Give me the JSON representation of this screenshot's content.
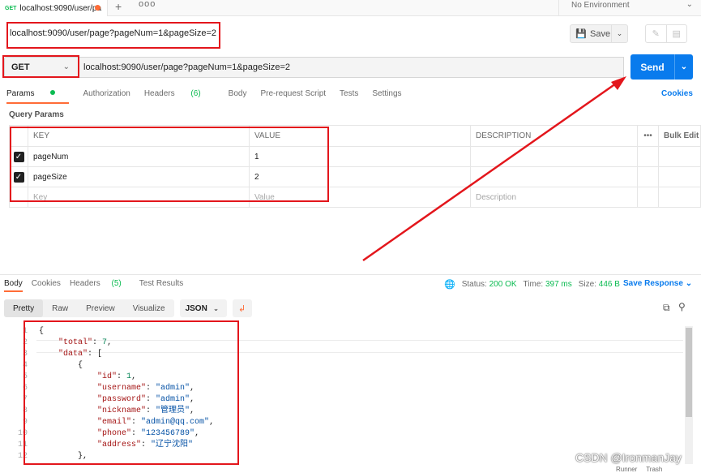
{
  "tab": {
    "method": "GET",
    "title": "localhost:9090/user/pa"
  },
  "new_tab_symbol": "+",
  "more_symbol": "ooo",
  "environment": {
    "label": "No Environment"
  },
  "request": {
    "name": "localhost:9090/user/page?pageNum=1&pageSize=2",
    "method": "GET",
    "url": "localhost:9090/user/page?pageNum=1&pageSize=2"
  },
  "toolbar": {
    "save_label": "Save",
    "send_label": "Send"
  },
  "request_tabs": {
    "params": "Params",
    "authorization": "Authorization",
    "headers": "Headers",
    "headers_count": "(6)",
    "body": "Body",
    "prerequest": "Pre-request Script",
    "tests": "Tests",
    "settings": "Settings",
    "cookies": "Cookies"
  },
  "query_params": {
    "title": "Query Params",
    "headers": {
      "key": "KEY",
      "value": "VALUE",
      "description": "DESCRIPTION",
      "dots": "•••",
      "bulk": "Bulk Edit"
    },
    "rows": [
      {
        "key": "pageNum",
        "value": "1"
      },
      {
        "key": "pageSize",
        "value": "2"
      }
    ],
    "placeholder": {
      "key": "Key",
      "value": "Value",
      "description": "Description"
    }
  },
  "response_tabs": {
    "body": "Body",
    "cookies": "Cookies",
    "headers": "Headers",
    "headers_count": "(5)",
    "test_results": "Test Results"
  },
  "response_status": {
    "status_label": "Status:",
    "status_value": "200 OK",
    "time_label": "Time:",
    "time_value": "397 ms",
    "size_label": "Size:",
    "size_value": "446 B",
    "save_response": "Save Response"
  },
  "format_bar": {
    "pretty": "Pretty",
    "raw": "Raw",
    "preview": "Preview",
    "visualize": "Visualize",
    "format": "JSON"
  },
  "response_body": [
    {
      "ln": "1",
      "tokens": [
        [
          "p",
          "{"
        ]
      ]
    },
    {
      "ln": "2",
      "tokens": [
        [
          "p",
          "    "
        ],
        [
          "k",
          "\"total\""
        ],
        [
          "p",
          ": "
        ],
        [
          "n",
          "7"
        ],
        [
          "p",
          ","
        ]
      ]
    },
    {
      "ln": "3",
      "tokens": [
        [
          "p",
          "    "
        ],
        [
          "k",
          "\"data\""
        ],
        [
          "p",
          ": ["
        ]
      ]
    },
    {
      "ln": "4",
      "tokens": [
        [
          "p",
          "        {"
        ]
      ]
    },
    {
      "ln": "5",
      "tokens": [
        [
          "p",
          "            "
        ],
        [
          "k",
          "\"id\""
        ],
        [
          "p",
          ": "
        ],
        [
          "n",
          "1"
        ],
        [
          "p",
          ","
        ]
      ]
    },
    {
      "ln": "6",
      "tokens": [
        [
          "p",
          "            "
        ],
        [
          "k",
          "\"username\""
        ],
        [
          "p",
          ": "
        ],
        [
          "s",
          "\"admin\""
        ],
        [
          "p",
          ","
        ]
      ]
    },
    {
      "ln": "7",
      "tokens": [
        [
          "p",
          "            "
        ],
        [
          "k",
          "\"password\""
        ],
        [
          "p",
          ": "
        ],
        [
          "s",
          "\"admin\""
        ],
        [
          "p",
          ","
        ]
      ]
    },
    {
      "ln": "8",
      "tokens": [
        [
          "p",
          "            "
        ],
        [
          "k",
          "\"nickname\""
        ],
        [
          "p",
          ": "
        ],
        [
          "s",
          "\"管理员\""
        ],
        [
          "p",
          ","
        ]
      ]
    },
    {
      "ln": "9",
      "tokens": [
        [
          "p",
          "            "
        ],
        [
          "k",
          "\"email\""
        ],
        [
          "p",
          ": "
        ],
        [
          "s",
          "\"admin@qq.com\""
        ],
        [
          "p",
          ","
        ]
      ]
    },
    {
      "ln": "10",
      "tokens": [
        [
          "p",
          "            "
        ],
        [
          "k",
          "\"phone\""
        ],
        [
          "p",
          ": "
        ],
        [
          "s",
          "\"123456789\""
        ],
        [
          "p",
          ","
        ]
      ]
    },
    {
      "ln": "11",
      "tokens": [
        [
          "p",
          "            "
        ],
        [
          "k",
          "\"address\""
        ],
        [
          "p",
          ": "
        ],
        [
          "s",
          "\"辽宁沈阳\""
        ]
      ]
    },
    {
      "ln": "12",
      "tokens": [
        [
          "p",
          "        },"
        ]
      ]
    }
  ],
  "watermark": "CSDN @IronmanJay",
  "footer": {
    "runner": "Runner",
    "trash": "Trash"
  },
  "annotation_color": "#e3161c"
}
